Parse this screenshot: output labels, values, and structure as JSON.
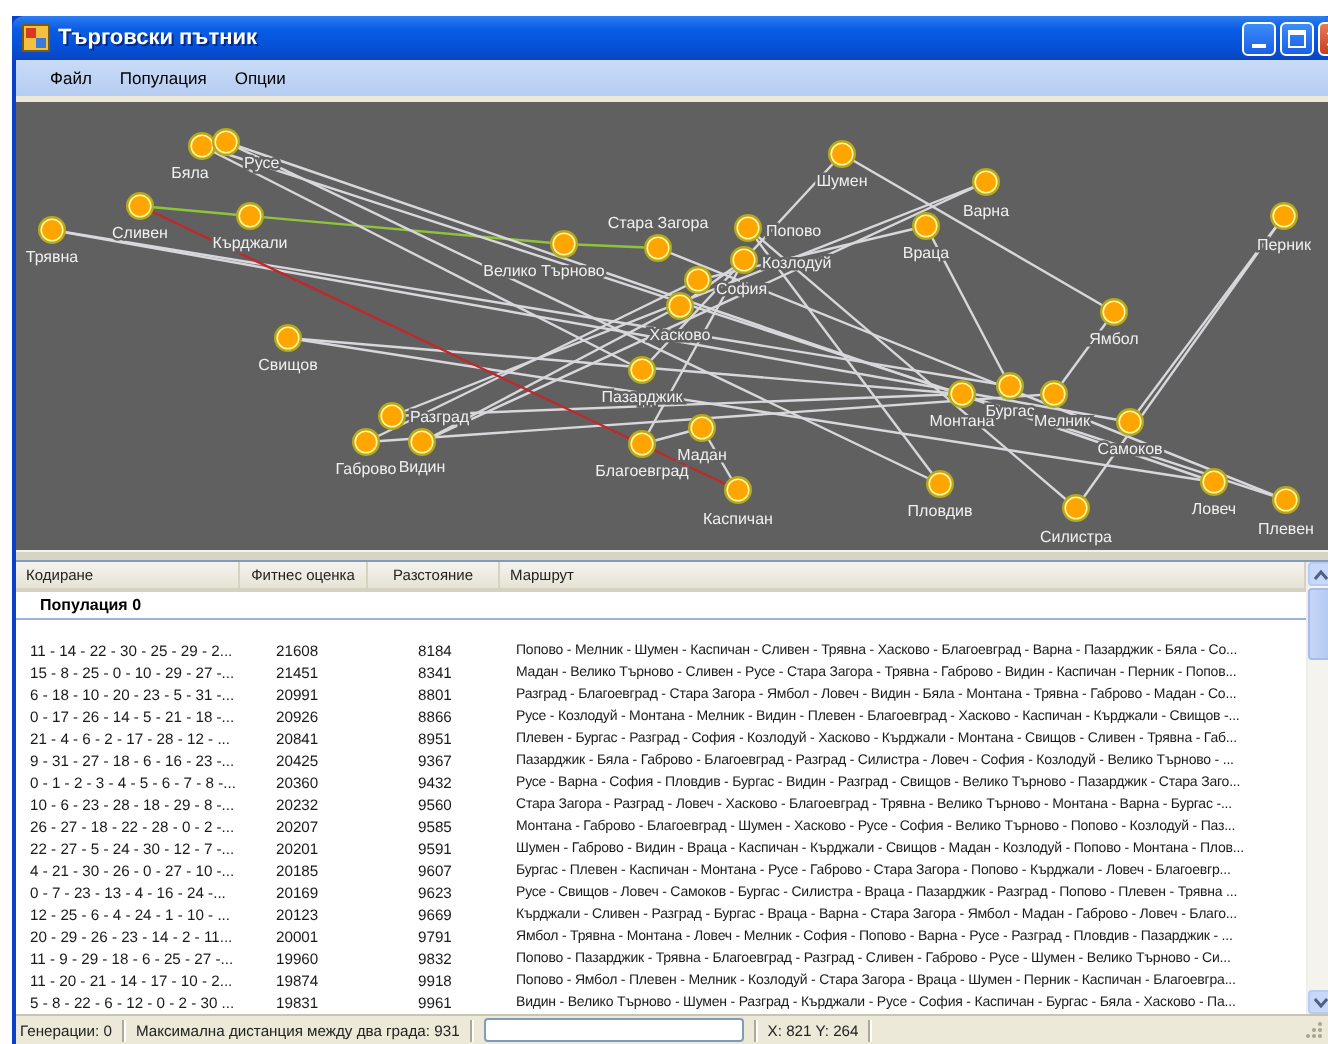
{
  "window": {
    "title": "Търговски пътник"
  },
  "menu": [
    "Файл",
    "Популация",
    "Опции"
  ],
  "map": {
    "cities": [
      "Бяла",
      "Русе",
      "Сливен",
      "Кърджали",
      "Трявна",
      "Велико Търново",
      "Стара Загора",
      "Попово",
      "Козлодуй",
      "София",
      "Хасково",
      "Свищов",
      "Пазарджик",
      "Разград",
      "Габрово",
      "Видин",
      "Благоевград",
      "Мадан",
      "Каспичан",
      "Шумен",
      "Варна",
      "Враца",
      "Перник",
      "Ямбол",
      "Монтана",
      "Бургас",
      "Мелник",
      "Самоков",
      "Пловдив",
      "Силистра",
      "Ловеч",
      "Плевен"
    ]
  },
  "table": {
    "columns": [
      "Кодиране",
      "Фитнес оценка",
      "Разстояние",
      "Маршрут"
    ],
    "group": "Популация 0",
    "rows": [
      {
        "encoding": "11 - 14 - 22 - 30 - 25 - 29 - 2...",
        "fitness": "21608",
        "distance": "8184",
        "route": "Попово - Мелник - Шумен - Каспичан - Сливен - Трявна - Хасково - Благоевград - Варна - Пазарджик - Бяла - Со..."
      },
      {
        "encoding": "15 - 8 - 25 - 0 - 10 - 29 - 27 -...",
        "fitness": "21451",
        "distance": "8341",
        "route": "Мадан - Велико Търново - Сливен - Русе - Стара Загора - Трявна - Габрово - Видин - Каспичан - Перник - Попов..."
      },
      {
        "encoding": "6 - 18 - 10 - 20 - 23 - 5 - 31 -...",
        "fitness": "20991",
        "distance": "8801",
        "route": "Разград - Благоевград - Стара Загора - Ямбол - Ловеч - Видин - Бяла - Монтана - Трявна - Габрово - Мадан - Со..."
      },
      {
        "encoding": "0 - 17 - 26 - 14 - 5 - 21 - 18 -...",
        "fitness": "20926",
        "distance": "8866",
        "route": "Русе - Козлодуй - Монтана - Мелник - Видин - Плевен - Благоевград - Хасково - Каспичан - Кърджали - Свищов -..."
      },
      {
        "encoding": "21 - 4 - 6 - 2 - 17 - 28 - 12 - ...",
        "fitness": "20841",
        "distance": "8951",
        "route": "Плевен - Бургас - Разград - София - Козлодуй - Хасково - Кърджали - Монтана - Свищов - Сливен - Трявна - Габ..."
      },
      {
        "encoding": "9 - 31 - 27 - 18 - 6 - 16 - 23 -...",
        "fitness": "20425",
        "distance": "9367",
        "route": "Пазарджик - Бяла - Габрово - Благоевград - Разград - Силистра - Ловеч - София - Козлодуй - Велико Търново - ..."
      },
      {
        "encoding": "0 - 1 - 2 - 3 - 4 - 5 - 6 - 7 - 8 -...",
        "fitness": "20360",
        "distance": "9432",
        "route": "Русе - Варна - София - Пловдив - Бургас - Видин - Разград - Свищов - Велико Търново - Пазарджик - Стара Заго..."
      },
      {
        "encoding": "10 - 6 - 23 - 28 - 18 - 29 - 8 -...",
        "fitness": "20232",
        "distance": "9560",
        "route": "Стара Загора - Разград - Ловеч - Хасково - Благоевград - Трявна - Велико Търново - Монтана - Варна - Бургас -..."
      },
      {
        "encoding": "26 - 27 - 18 - 22 - 28 - 0 - 2 -...",
        "fitness": "20207",
        "distance": "9585",
        "route": "Монтана - Габрово - Благоевград - Шумен - Хасково - Русе - София - Велико Търново - Попово - Козлодуй - Паз..."
      },
      {
        "encoding": "22 - 27 - 5 - 24 - 30 - 12 - 7 -...",
        "fitness": "20201",
        "distance": "9591",
        "route": "Шумен - Габрово - Видин - Враца - Каспичан - Кърджали - Свищов - Мадан - Козлодуй - Попово - Монтана - Плов..."
      },
      {
        "encoding": "4 - 21 - 30 - 26 - 0 - 27 - 10 -...",
        "fitness": "20185",
        "distance": "9607",
        "route": "Бургас - Плевен - Каспичан - Монтана - Русе - Габрово - Стара Загора - Попово - Кърджали - Ловеч - Благоевгр..."
      },
      {
        "encoding": "0 - 7 - 23 - 13 - 4 - 16 - 24 -...",
        "fitness": "20169",
        "distance": "9623",
        "route": "Русе - Свищов - Ловеч - Самоков - Бургас - Силистра - Враца - Пазарджик - Разград - Попово - Плевен - Трявна ..."
      },
      {
        "encoding": "12 - 25 - 6 - 4 - 24 - 1 - 10 - ...",
        "fitness": "20123",
        "distance": "9669",
        "route": "Кърджали - Сливен - Разград - Бургас - Враца - Варна - Стара Загора - Ямбол - Мадан - Габрово - Ловеч - Благо..."
      },
      {
        "encoding": "20 - 29 - 26 - 23 - 14 - 2 - 11...",
        "fitness": "20001",
        "distance": "9791",
        "route": "Ямбол - Трявна - Монтана - Ловеч - Мелник - София - Попово - Варна - Русе - Разград - Пловдив - Пазарджик - ..."
      },
      {
        "encoding": "11 - 9 - 29 - 18 - 6 - 25 - 27 -...",
        "fitness": "19960",
        "distance": "9832",
        "route": "Попово - Пазарджик - Трявна - Благоевград - Разград - Сливен - Габрово - Русе - Шумен - Велико Търново - Си..."
      },
      {
        "encoding": "11 - 20 - 21 - 14 - 17 - 10 - 2...",
        "fitness": "19874",
        "distance": "9918",
        "route": "Попово - Ямбол - Плевен - Мелник - Козлодуй - Стара Загора - Враца - Шумен - Перник - Каспичан - Благоевгра..."
      },
      {
        "encoding": "5 - 8 - 22 - 6 - 12 - 0 - 2 - 30 ...",
        "fitness": "19831",
        "distance": "9961",
        "route": "Видин - Велико Търново - Шумен - Разград - Кърджали - Русе - София - Каспичан - Бургас - Бяла - Хасково - Па..."
      }
    ]
  },
  "status_bar": {
    "generations": "Генерации: 0",
    "max_distance": "Максимална дистанция между два града: 931",
    "coordinates": "X: 821 Y: 264"
  }
}
